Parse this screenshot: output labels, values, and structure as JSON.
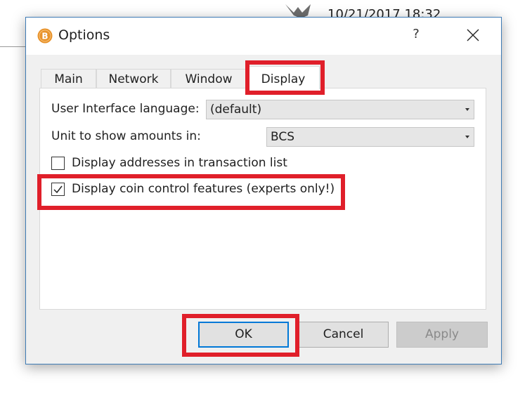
{
  "background": {
    "datetime": "10/21/2017 18:32"
  },
  "dialog": {
    "title": "Options",
    "help": "?",
    "tabs": [
      {
        "label": "Main"
      },
      {
        "label": "Network"
      },
      {
        "label": "Window"
      },
      {
        "label": "Display",
        "active": true
      }
    ],
    "display": {
      "language_label": "User Interface language:",
      "language_value": "(default)",
      "unit_label": "Unit to show amounts in:",
      "unit_value": "BCS",
      "checkboxes": [
        {
          "label": "Display addresses in transaction list",
          "checked": false
        },
        {
          "label": "Display coin control features (experts only!)",
          "checked": true
        }
      ]
    },
    "buttons": {
      "ok": "OK",
      "cancel": "Cancel",
      "apply": "Apply"
    }
  },
  "colors": {
    "highlight": "#e01f2a",
    "accent_border": "#0078d7",
    "app_icon": "#e8922a"
  },
  "icons": {
    "app": "bitcoin-logo-icon",
    "close": "close-icon",
    "check": "checkmark-icon"
  }
}
